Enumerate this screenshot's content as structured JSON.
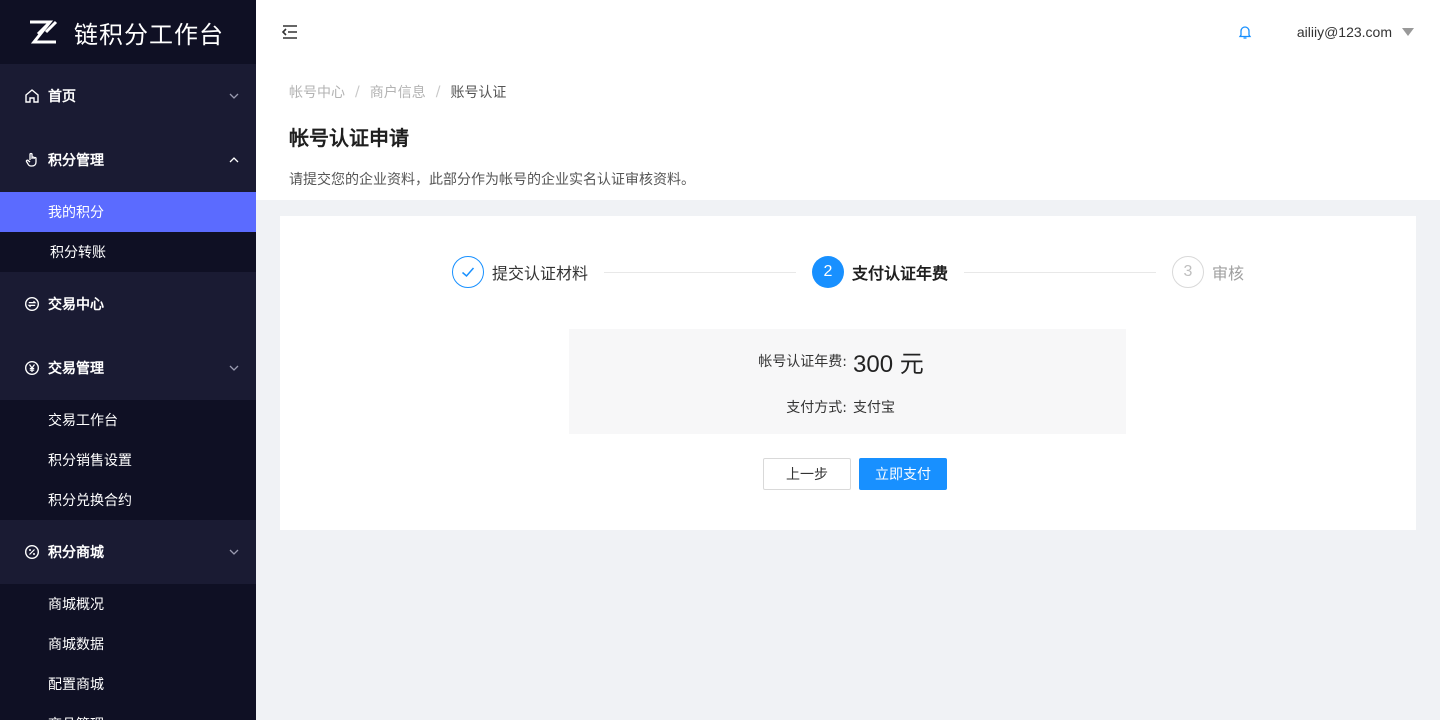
{
  "app": {
    "title": "链积分工作台"
  },
  "sidebar": {
    "groups": [
      {
        "label": "首页",
        "icon": "home-icon",
        "expanded": false
      },
      {
        "label": "积分管理",
        "icon": "hand-pointer-icon",
        "expanded": true,
        "items": [
          {
            "label": "我的积分",
            "active": true
          },
          {
            "label": "积分转账"
          }
        ]
      },
      {
        "label": "交易中心",
        "icon": "exchange-circle-icon",
        "expanded": false
      },
      {
        "label": "交易管理",
        "icon": "yen-circle-icon",
        "expanded": true,
        "items": [
          {
            "label": "交易工作台"
          },
          {
            "label": "积分销售设置"
          },
          {
            "label": "积分兑换合约"
          }
        ]
      },
      {
        "label": "积分商城",
        "icon": "percent-circle-icon",
        "expanded": true,
        "items": [
          {
            "label": "商城概况"
          },
          {
            "label": "商城数据"
          },
          {
            "label": "配置商城"
          },
          {
            "label": "商品管理"
          }
        ]
      }
    ]
  },
  "header": {
    "user_email": "ailiiy@123.com"
  },
  "breadcrumb": [
    "帐号中心",
    "商户信息",
    "账号认证"
  ],
  "page": {
    "title": "帐号认证申请",
    "description": "请提交您的企业资料，此部分作为帐号的企业实名认证审核资料。"
  },
  "steps": [
    {
      "index": "1",
      "title": "提交认证材料",
      "status": "done"
    },
    {
      "index": "2",
      "title": "支付认证年费",
      "status": "active"
    },
    {
      "index": "3",
      "title": "审核",
      "status": "wait"
    }
  ],
  "payment": {
    "fee_label": "帐号认证年费:",
    "fee_value": "300 元",
    "method_label": "支付方式:",
    "method_value": "支付宝"
  },
  "buttons": {
    "prev": "上一步",
    "pay": "立即支付"
  },
  "colors": {
    "primary": "#1890ff",
    "sidebar_bg": "#0f1024",
    "sidebar_group_bg": "#1a1b33",
    "active_item": "#5b6bff"
  }
}
